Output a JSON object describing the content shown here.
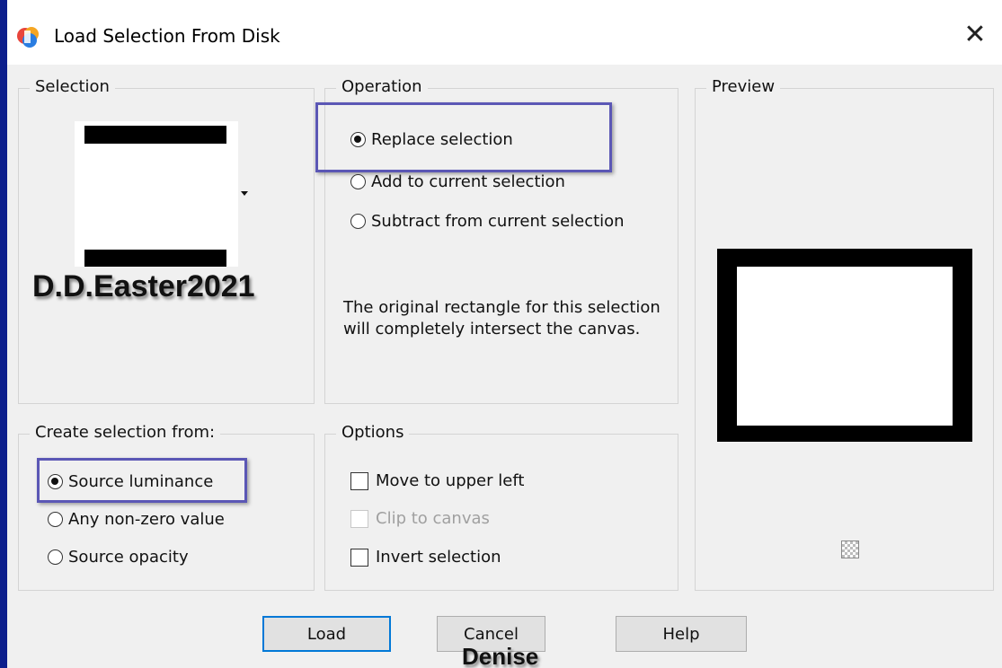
{
  "window": {
    "title": "Load Selection From Disk",
    "close_symbol": "✕"
  },
  "selection": {
    "legend": "Selection",
    "watermark": "D.D.Easter2021"
  },
  "operation": {
    "legend": "Operation",
    "options": [
      {
        "label": "Replace selection",
        "checked": true
      },
      {
        "label": "Add to current selection",
        "checked": false
      },
      {
        "label": "Subtract from current selection",
        "checked": false
      }
    ],
    "note": "The original rectangle for this selection will completely intersect the canvas."
  },
  "preview": {
    "legend": "Preview"
  },
  "create_from": {
    "legend": "Create selection from:",
    "options": [
      {
        "label": "Source luminance",
        "checked": true
      },
      {
        "label": "Any non-zero value",
        "checked": false
      },
      {
        "label": "Source opacity",
        "checked": false
      }
    ]
  },
  "options": {
    "legend": "Options",
    "items": [
      {
        "label": "Move to upper left",
        "checked": false,
        "enabled": true
      },
      {
        "label": "Clip to canvas",
        "checked": false,
        "enabled": false
      },
      {
        "label": "Invert selection",
        "checked": false,
        "enabled": true
      }
    ]
  },
  "buttons": {
    "load": "Load",
    "cancel": "Cancel",
    "help": "Help"
  },
  "signature": "Denise",
  "colors": {
    "highlight": "#5b57b5",
    "default_button_border": "#0078d7",
    "outer_frame": "#0d1f8c"
  }
}
